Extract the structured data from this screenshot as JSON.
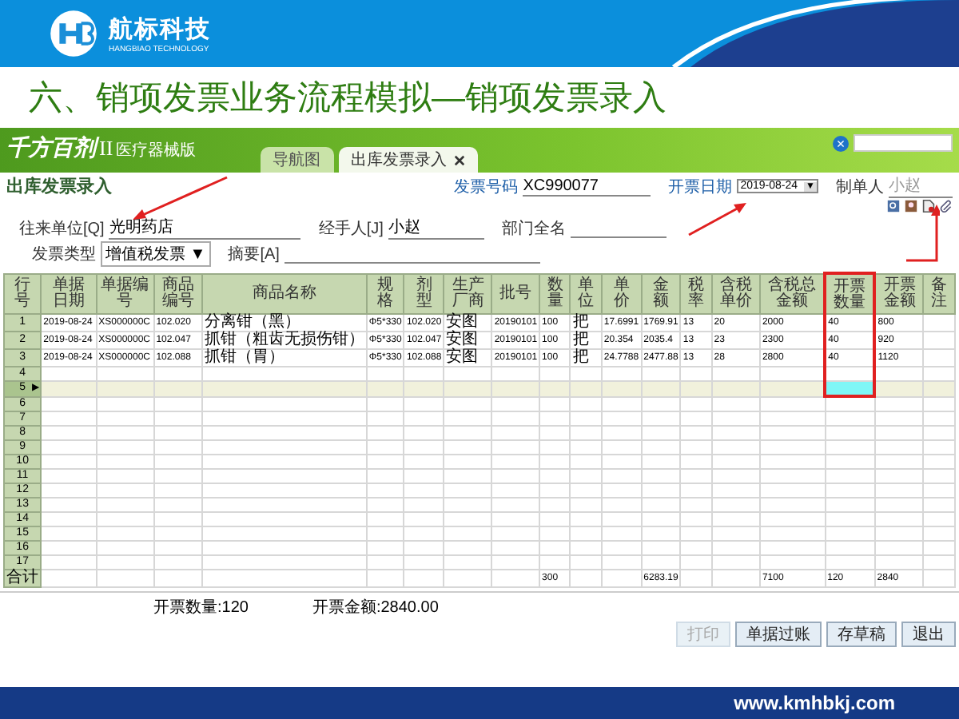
{
  "slide": {
    "brand": "航标科技",
    "brand_sub": "HANGBIAO TECHNOLOGY",
    "title": "六、销项发票业务流程模拟—销项发票录入",
    "footer": "www.kmhbkj.com"
  },
  "app": {
    "logo": "千方百剂",
    "logo_mark": "II",
    "edition": "医疗器械版",
    "tabs": [
      {
        "label": "导航图",
        "selected": false,
        "closable": false
      },
      {
        "label": "出库发票录入",
        "selected": true,
        "closable": true
      }
    ],
    "search_close": "×"
  },
  "form": {
    "title": "出库发票录入",
    "invoice_no_label": "发票号码",
    "invoice_no": "XC990077",
    "date_label": "开票日期",
    "date": "2019-08-24",
    "date_button": "▼",
    "maker_label": "制单人",
    "maker": "小赵",
    "partner_label": "往来单位[Q]",
    "partner": "光明药店",
    "handler_label": "经手人[J]",
    "handler": "小赵",
    "dept_label": "部门全名",
    "type_label": "发票类型",
    "type": "增值税发票 ▼",
    "memo_label": "摘要[A]"
  },
  "table": {
    "row_pointer": "▶",
    "columns": [
      {
        "label": "行号",
        "highlighted": false
      },
      {
        "label": "单据日期",
        "highlighted": false
      },
      {
        "label": "单据编号",
        "highlighted": false
      },
      {
        "label": "商品编号",
        "highlighted": false
      },
      {
        "label": "商品名称",
        "highlighted": false
      },
      {
        "label": "规格",
        "highlighted": false
      },
      {
        "label": "剂型",
        "highlighted": false
      },
      {
        "label": "生产厂商",
        "highlighted": false
      },
      {
        "label": "批号",
        "highlighted": false
      },
      {
        "label": "数量",
        "highlighted": false
      },
      {
        "label": "单位",
        "highlighted": false
      },
      {
        "label": "单价",
        "highlighted": false
      },
      {
        "label": "金额",
        "highlighted": false
      },
      {
        "label": "税率",
        "highlighted": false
      },
      {
        "label": "含税单价",
        "highlighted": false
      },
      {
        "label": "含税总金额",
        "highlighted": false
      },
      {
        "label": "开票数量",
        "highlighted": true
      },
      {
        "label": "开票金额",
        "highlighted": false
      },
      {
        "label": "备注",
        "highlighted": false
      }
    ],
    "rows": [
      {
        "no": "1",
        "selected": false,
        "cells": [
          "2019-08-24",
          "XS000000C",
          "102.020",
          "分离钳（黑）",
          "Φ5*330",
          "102.020",
          "安图",
          "20190101",
          "100",
          "把",
          "17.6991",
          "1769.91",
          "13",
          "20",
          "2000",
          "40",
          "800"
        ]
      },
      {
        "no": "2",
        "selected": false,
        "cells": [
          "2019-08-24",
          "XS000000C",
          "102.047",
          "抓钳（粗齿无损伤钳）",
          "Φ5*330",
          "102.047",
          "安图",
          "20190101",
          "100",
          "把",
          "20.354",
          "2035.4",
          "13",
          "23",
          "2300",
          "40",
          "920"
        ]
      },
      {
        "no": "3",
        "selected": false,
        "cells": [
          "2019-08-24",
          "XS000000C",
          "102.088",
          "抓钳（胃）",
          "Φ5*330",
          "102.088",
          "安图",
          "20190101",
          "100",
          "把",
          "24.7788",
          "2477.88",
          "13",
          "28",
          "2800",
          "40",
          "1120"
        ]
      },
      {
        "no": "4",
        "selected": false
      },
      {
        "no": "5",
        "selected": true
      },
      {
        "no": "6",
        "selected": false
      },
      {
        "no": "7",
        "selected": false
      },
      {
        "no": "8",
        "selected": false
      },
      {
        "no": "9",
        "selected": false
      },
      {
        "no": "10",
        "selected": false
      },
      {
        "no": "11",
        "selected": false
      },
      {
        "no": "12",
        "selected": false
      },
      {
        "no": "13",
        "selected": false
      },
      {
        "no": "14",
        "selected": false
      },
      {
        "no": "15",
        "selected": false
      },
      {
        "no": "16",
        "selected": false
      },
      {
        "no": "17",
        "selected": false
      }
    ],
    "totals": {
      "label": "合计",
      "cells": [
        null,
        null,
        null,
        null,
        null,
        null,
        null,
        null,
        "300",
        null,
        null,
        "6283.19",
        null,
        null,
        "7100",
        "120",
        "2840",
        null
      ]
    }
  },
  "summary": [
    {
      "label": "开票数量:",
      "value": "120"
    },
    {
      "label": "开票金额:",
      "value": "2840.00"
    }
  ],
  "buttons": [
    {
      "label": "打印",
      "disabled": true
    },
    {
      "label": "单据过账",
      "disabled": false
    },
    {
      "label": "存草稿",
      "disabled": false
    },
    {
      "label": "退出",
      "disabled": false
    }
  ]
}
